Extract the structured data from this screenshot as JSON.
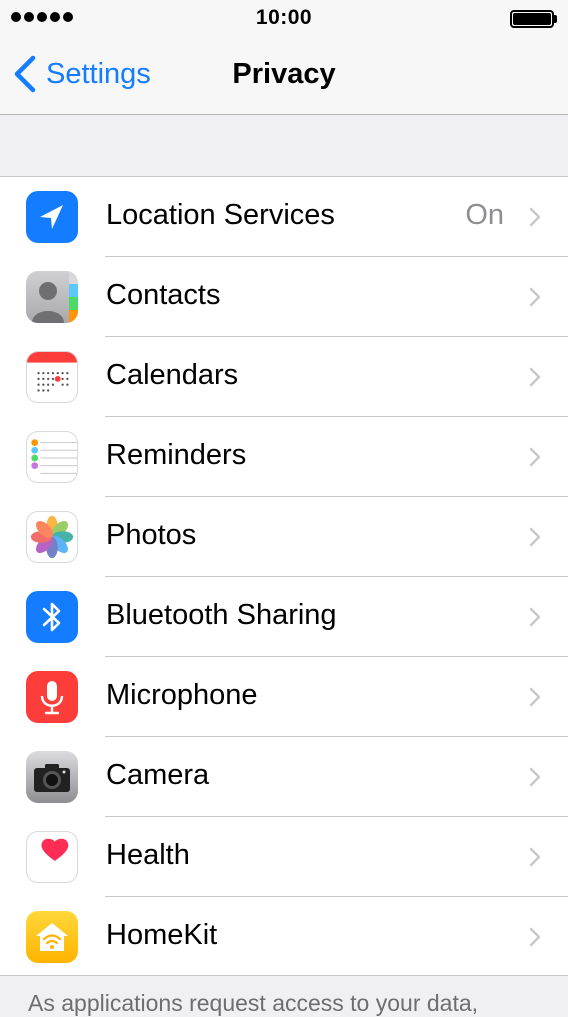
{
  "status_bar": {
    "time": "10:00",
    "signal_dots": 5
  },
  "nav": {
    "back_label": "Settings",
    "title": "Privacy"
  },
  "rows": [
    {
      "label": "Location Services",
      "value": "On",
      "icon": "location-arrow-icon",
      "color": "#137cff"
    },
    {
      "label": "Contacts",
      "value": "",
      "icon": "contacts-icon",
      "color": "#8e8e93"
    },
    {
      "label": "Calendars",
      "value": "",
      "icon": "calendar-icon",
      "color": "#fc3d39"
    },
    {
      "label": "Reminders",
      "value": "",
      "icon": "reminders-icon",
      "color": "#ffffff"
    },
    {
      "label": "Photos",
      "value": "",
      "icon": "photos-icon",
      "color": "#ffffff"
    },
    {
      "label": "Bluetooth Sharing",
      "value": "",
      "icon": "bluetooth-icon",
      "color": "#137cff"
    },
    {
      "label": "Microphone",
      "value": "",
      "icon": "microphone-icon",
      "color": "#fc3d39"
    },
    {
      "label": "Camera",
      "value": "",
      "icon": "camera-icon",
      "color": "#7a7a7f"
    },
    {
      "label": "Health",
      "value": "",
      "icon": "heart-icon",
      "color": "#ff2d55"
    },
    {
      "label": "HomeKit",
      "value": "",
      "icon": "homekit-icon",
      "color": "#ffc300"
    }
  ],
  "footer": {
    "text": "As applications request access to your data,"
  }
}
